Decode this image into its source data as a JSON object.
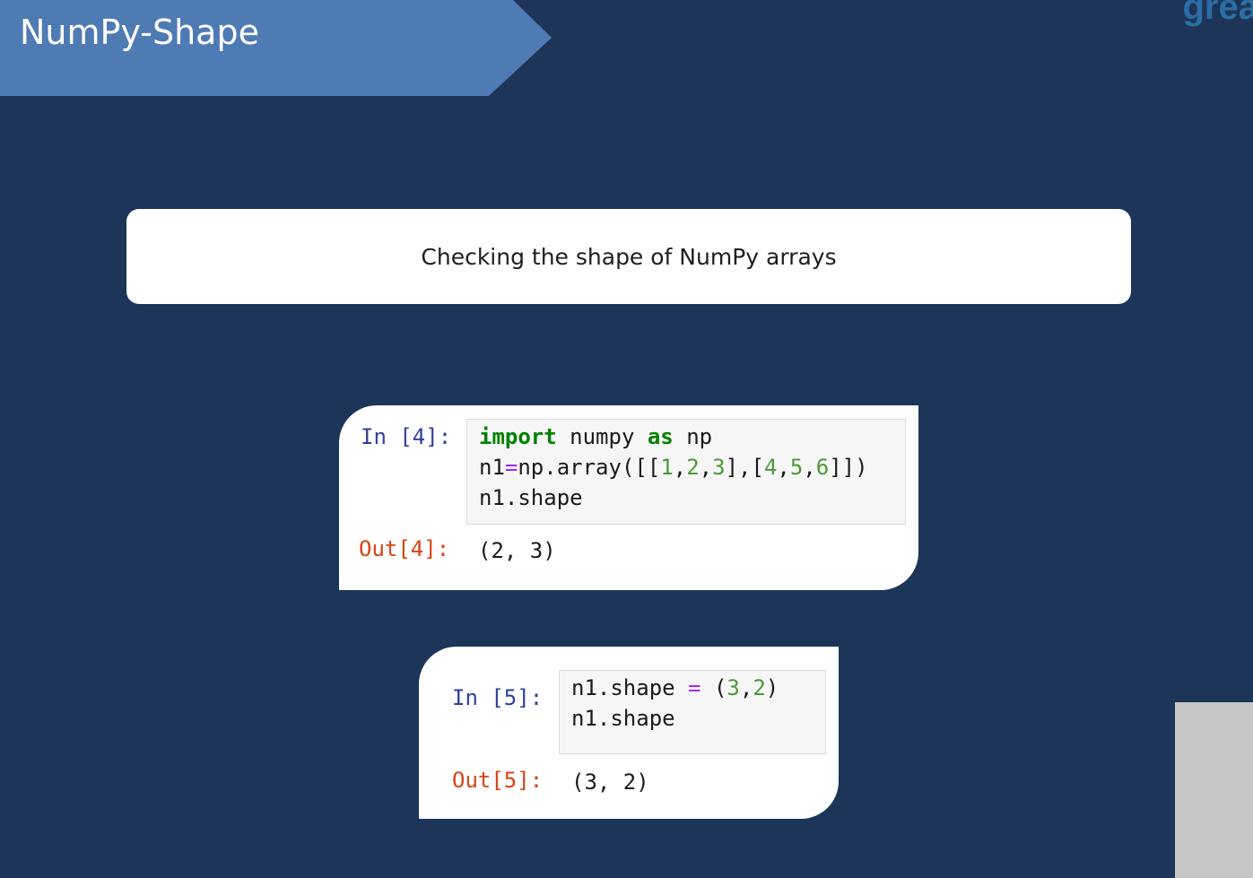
{
  "slide": {
    "title": "NumPy-Shape",
    "logo_text": "grea",
    "subtitle": "Checking the shape of NumPy arrays"
  },
  "cells": [
    {
      "in_prompt": "In [4]:",
      "code_lines": [
        [
          {
            "t": "import",
            "c": "kw"
          },
          {
            "t": " numpy "
          },
          {
            "t": "as",
            "c": "kw"
          },
          {
            "t": " np"
          }
        ],
        [
          {
            "t": "n1"
          },
          {
            "t": "=",
            "c": "op"
          },
          {
            "t": "np.array([["
          },
          {
            "t": "1",
            "c": "num"
          },
          {
            "t": ","
          },
          {
            "t": "2",
            "c": "num"
          },
          {
            "t": ","
          },
          {
            "t": "3",
            "c": "num"
          },
          {
            "t": "],["
          },
          {
            "t": "4",
            "c": "num"
          },
          {
            "t": ","
          },
          {
            "t": "5",
            "c": "num"
          },
          {
            "t": ","
          },
          {
            "t": "6",
            "c": "num"
          },
          {
            "t": "]])"
          }
        ],
        [
          {
            "t": "n1.shape"
          }
        ]
      ],
      "out_prompt": "Out[4]:",
      "output": "(2, 3)"
    },
    {
      "in_prompt": "In [5]:",
      "code_lines": [
        [
          {
            "t": "n1.shape "
          },
          {
            "t": "=",
            "c": "op"
          },
          {
            "t": " ("
          },
          {
            "t": "3",
            "c": "num"
          },
          {
            "t": ","
          },
          {
            "t": "2",
            "c": "num"
          },
          {
            "t": ")"
          }
        ],
        [
          {
            "t": "n1.shape"
          }
        ]
      ],
      "out_prompt": "Out[5]:",
      "output": "(3, 2)"
    }
  ],
  "colors": {
    "background": "#1c3558",
    "banner": "#4f7bb4",
    "in_prompt": "#303f9f",
    "out_prompt": "#d84315",
    "keyword": "#008000",
    "operator": "#aa22ff",
    "number": "#4d9a3a"
  }
}
